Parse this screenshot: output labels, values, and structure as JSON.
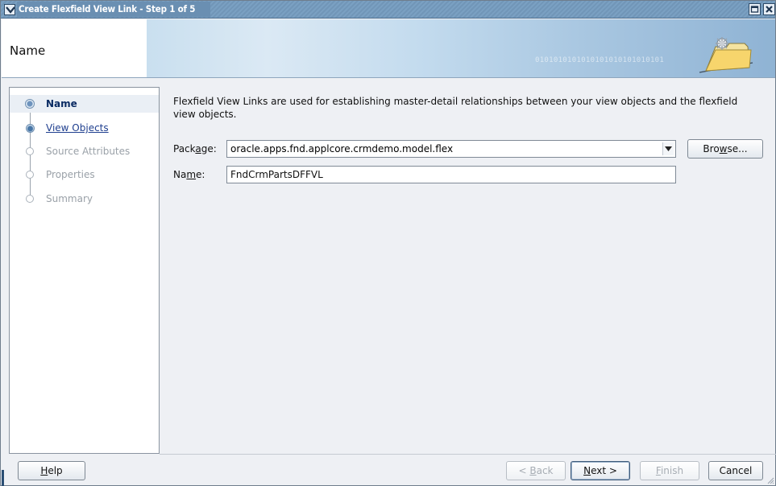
{
  "window": {
    "title": "Create Flexfield View Link - Step 1 of 5"
  },
  "header": {
    "title": "Name",
    "binary_text": "0101010101010101010101010101"
  },
  "nav": {
    "items": [
      {
        "label": "Name",
        "state": "active"
      },
      {
        "label": "View Objects",
        "state": "link"
      },
      {
        "label": "Source Attributes",
        "state": "disabled"
      },
      {
        "label": "Properties",
        "state": "disabled"
      },
      {
        "label": "Summary",
        "state": "disabled"
      }
    ]
  },
  "content": {
    "description": "Flexfield View Links are used for establishing master-detail relationships between your view objects and the flexfield view objects.",
    "package_label_pre": "Pack",
    "package_label_mn": "a",
    "package_label_post": "ge:",
    "package_value": "oracle.apps.fnd.applcore.crmdemo.model.flex",
    "browse_label_pre": "Bro",
    "browse_label_mn": "w",
    "browse_label_post": "se...",
    "name_label_pre": "Na",
    "name_label_mn": "m",
    "name_label_post": "e:",
    "name_value": "FndCrmPartsDFFVL"
  },
  "footer": {
    "help_mn": "H",
    "help_rest": "elp",
    "back_pre": "< ",
    "back_mn": "B",
    "back_rest": "ack",
    "next_mn": "N",
    "next_rest": "ext >",
    "finish_mn": "F",
    "finish_rest": "inish",
    "cancel": "Cancel"
  },
  "colors": {
    "titlebar": "#7196b8",
    "active_nav_text": "#0a2b63",
    "link_text": "#1f3f8f"
  }
}
